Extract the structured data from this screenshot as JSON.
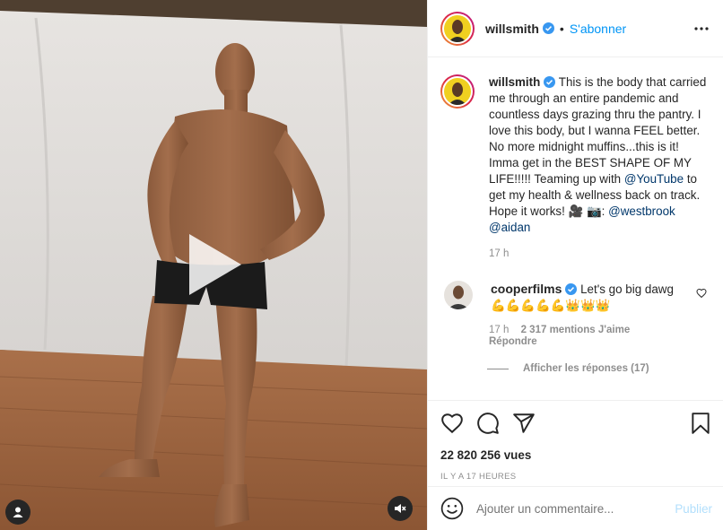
{
  "header": {
    "username": "willsmith",
    "separator": "•",
    "follow_label": "S'abonner",
    "more_icon": "more-horizontal-icon"
  },
  "caption": {
    "username": "willsmith",
    "text": "This is the body that carried me through an entire pandemic and countless days grazing thru the pantry. I love this body, but I wanna FEEL better. No more midnight muffins...this is it! Imma get in the BEST SHAPE OF MY LIFE!!!!! Teaming up with",
    "mention_youtube": "@YouTube",
    "text_after": "to get my health & wellness back on track. Hope it works!",
    "credit_prefix": "🎥 📷:",
    "mention_1": "@westbrook",
    "mention_2": "@aidan",
    "time": "17 h"
  },
  "comment": {
    "username": "cooperfilms",
    "text": "Let's go big dawg",
    "emoji_line": "💪💪💪💪💪👑👑👑",
    "time": "17 h",
    "likes": "2 317 mentions J'aime",
    "reply": "Répondre",
    "view_replies": "Afficher les réponses (17)"
  },
  "actions": {
    "like_icon": "heart-icon",
    "comment_icon": "comment-icon",
    "share_icon": "share-icon",
    "save_icon": "bookmark-icon",
    "views": "22 820 256 vues",
    "posted": "IL Y A 17 HEURES"
  },
  "add_comment": {
    "placeholder": "Ajouter un commentaire...",
    "publish": "Publier"
  },
  "colors": {
    "accent": "#0095f6",
    "text": "#262626",
    "muted": "#8e8e8e",
    "publish_disabled": "#b2dffc"
  }
}
